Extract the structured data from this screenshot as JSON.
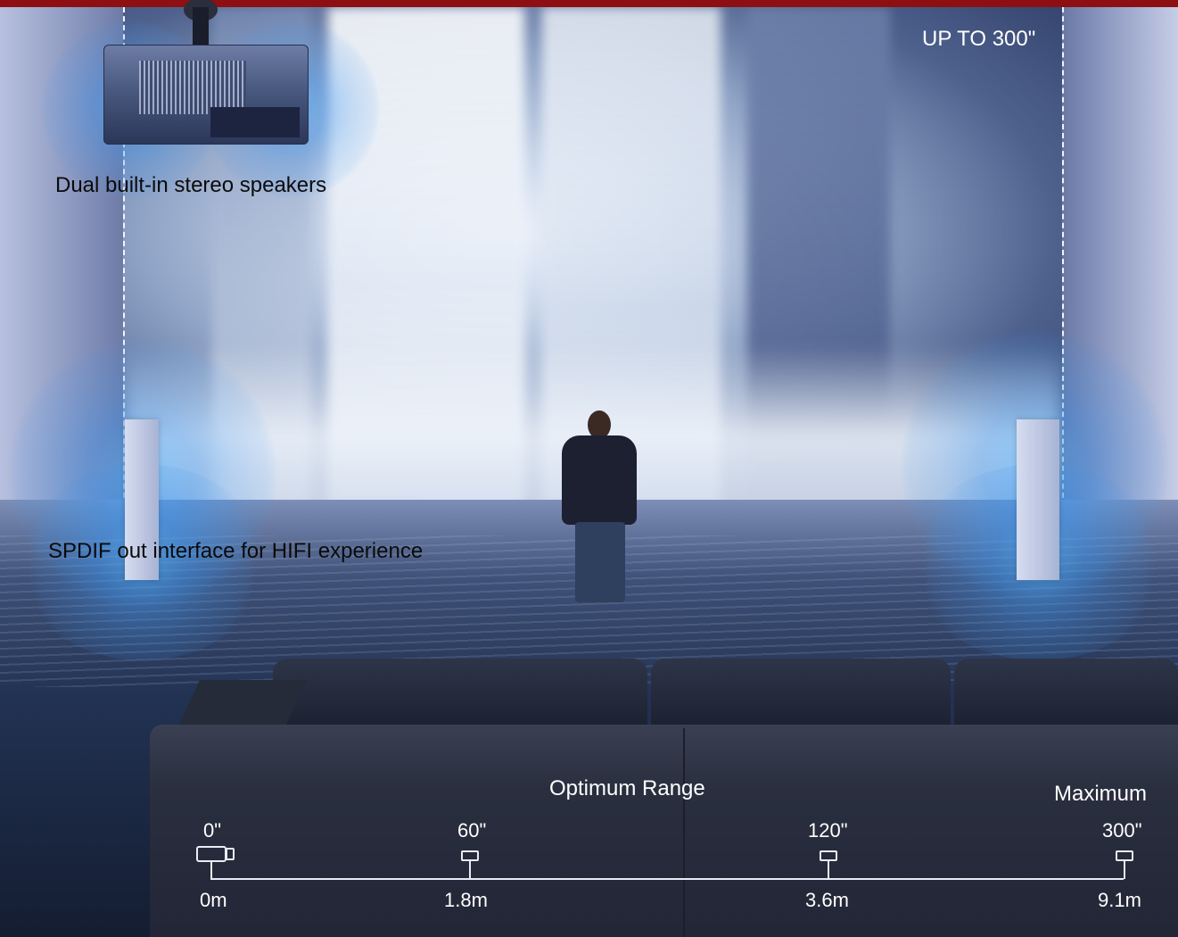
{
  "image": {
    "screen_size_label": "UP TO 300\"",
    "feature_speakers": "Dual built-in stereo speakers",
    "feature_spdif": "SPDIF out interface for HIFI experience",
    "optimum_label": "Optimum Range",
    "maximum_label": "Maximum",
    "scale": [
      {
        "size": "0\"",
        "distance": "0m"
      },
      {
        "size": "60\"",
        "distance": "1.8m"
      },
      {
        "size": "120\"",
        "distance": "3.6m"
      },
      {
        "size": "300\"",
        "distance": "9.1m"
      }
    ],
    "colors": {
      "accent_bar": "#8e0f12",
      "glow": "#3c96f0",
      "scale_line": "#e9ecf4"
    }
  }
}
